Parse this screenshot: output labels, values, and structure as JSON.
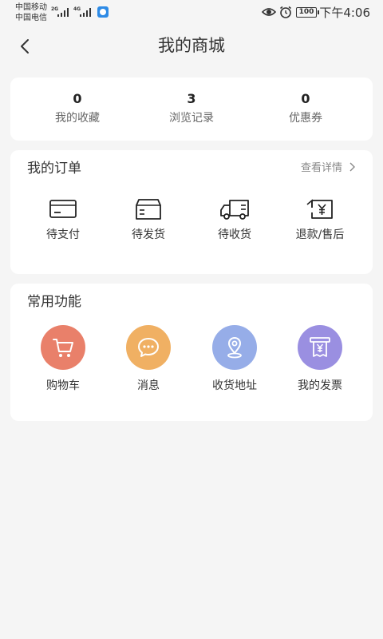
{
  "status_bar": {
    "carrier_1": "中国移动",
    "carrier_2": "中国电信",
    "network_1": "2G",
    "network_2": "4G",
    "battery": "100",
    "time": "下午4:06"
  },
  "header": {
    "title": "我的商城"
  },
  "stats": [
    {
      "value": "0",
      "label": "我的收藏"
    },
    {
      "value": "3",
      "label": "浏览记录"
    },
    {
      "value": "0",
      "label": "优惠券"
    }
  ],
  "orders": {
    "title": "我的订单",
    "view_details": "查看详情",
    "items": [
      {
        "label": "待支付",
        "icon": "card-icon"
      },
      {
        "label": "待发货",
        "icon": "box-icon"
      },
      {
        "label": "待收货",
        "icon": "truck-icon"
      },
      {
        "label": "退款/售后",
        "icon": "refund-icon"
      }
    ]
  },
  "functions": {
    "title": "常用功能",
    "items": [
      {
        "label": "购物车",
        "icon": "cart-icon",
        "color": "#e9806a"
      },
      {
        "label": "消息",
        "icon": "message-icon",
        "color": "#f0b063"
      },
      {
        "label": "收货地址",
        "icon": "location-icon",
        "color": "#96ade8"
      },
      {
        "label": "我的发票",
        "icon": "invoice-icon",
        "color": "#9a8fe1"
      }
    ]
  }
}
